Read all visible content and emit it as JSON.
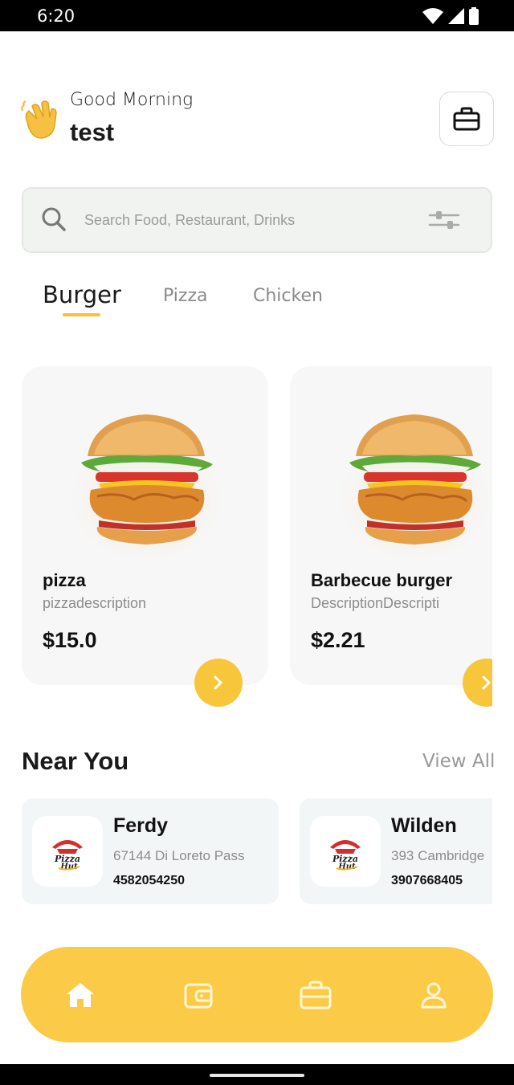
{
  "status_bar": {
    "time": "6:20"
  },
  "header": {
    "greeting": "Good Morning",
    "username": "test",
    "wave_icon": "waving-hand-icon",
    "bag_icon": "briefcase-icon"
  },
  "search": {
    "placeholder": "Search Food, Restaurant, Drinks",
    "value": ""
  },
  "categories": [
    {
      "label": "Burger",
      "selected": true
    },
    {
      "label": "Pizza",
      "selected": false
    },
    {
      "label": "Chicken",
      "selected": false
    }
  ],
  "products": [
    {
      "name": "pizza",
      "description": "pizzadescription",
      "price": "$15.0"
    },
    {
      "name": "Barbecue burger",
      "description": "DescriptionDescripti",
      "price": "$2.21"
    }
  ],
  "near_you": {
    "title": "Near You",
    "view_all": "View All",
    "restaurants": [
      {
        "name": "Ferdy",
        "address": "67144 Di Loreto Pass",
        "phone": "4582054250",
        "logo_text": "Pizza Hut"
      },
      {
        "name": "Wilden",
        "address": "393 Cambridge",
        "phone": "3907668405",
        "logo_text": "Pizza Hut"
      }
    ]
  },
  "bottom_nav": {
    "items": [
      "home-icon",
      "wallet-icon",
      "briefcase-icon",
      "profile-icon"
    ],
    "active": "home-icon"
  },
  "colors": {
    "accent": "#f8c63a",
    "nav_bg": "#fbcb48",
    "card_bg": "#f7f7f7"
  }
}
